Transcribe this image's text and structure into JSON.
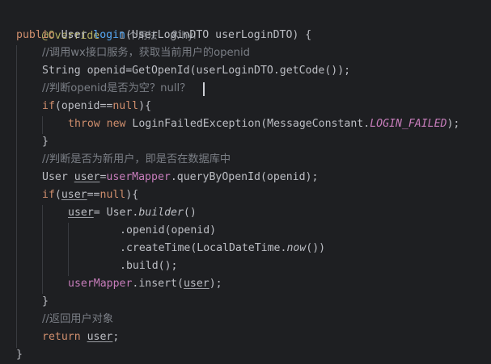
{
  "editor": {
    "hint": {
      "annotation": "@Override",
      "usages": "1 个用法",
      "author": "hyl"
    },
    "lines": {
      "l1_kw": "public",
      "l1_type": " User ",
      "l1_fn": "login",
      "l1_rest": "(UserLoginDTO userLoginDTO) {",
      "l2_comment": "//调用wx接口服务，获取当前用户的openid",
      "l3_pre": "String openid=GetOpenId(userLoginDTO.getCode());",
      "l4_comment": "//判断openid是否为空？null？",
      "l5_kw1": "if",
      "l5_mid": "(openid==",
      "l5_kw2": "null",
      "l5_end": "){",
      "l6_kw1": "throw",
      "l6_sp": " ",
      "l6_kw2": "new",
      "l6_mid": " LoginFailedException(MessageConstant.",
      "l6_const": "LOGIN_FAILED",
      "l6_end": ");",
      "l7": "}",
      "l8_comment": "//判断是否为新用户，即是否在数据库中",
      "l9_type": "User ",
      "l9_var": "user",
      "l9_eq": "=",
      "l9_fld": "userMapper",
      "l9_rest": ".queryByOpenId(openid);",
      "l10_kw1": "if",
      "l10_p": "(",
      "l10_var": "user",
      "l10_eq": "==",
      "l10_kw2": "null",
      "l10_end": "){",
      "l11_var": "user",
      "l11_mid": "= User.",
      "l11_fn": "builder",
      "l11_end": "()",
      "l12": ".openid(openid)",
      "l13_pre": ".createTime(LocalDateTime.",
      "l13_fn": "now",
      "l13_end": "())",
      "l14": ".build();",
      "l15_fld": "userMapper",
      "l15_mid": ".insert(",
      "l15_var": "user",
      "l15_end": ");",
      "l16": "}",
      "l17_comment": "//返回用户对象",
      "l18_kw": "return",
      "l18_sp": " ",
      "l18_var": "user",
      "l18_end": ";",
      "l19": "}"
    }
  }
}
